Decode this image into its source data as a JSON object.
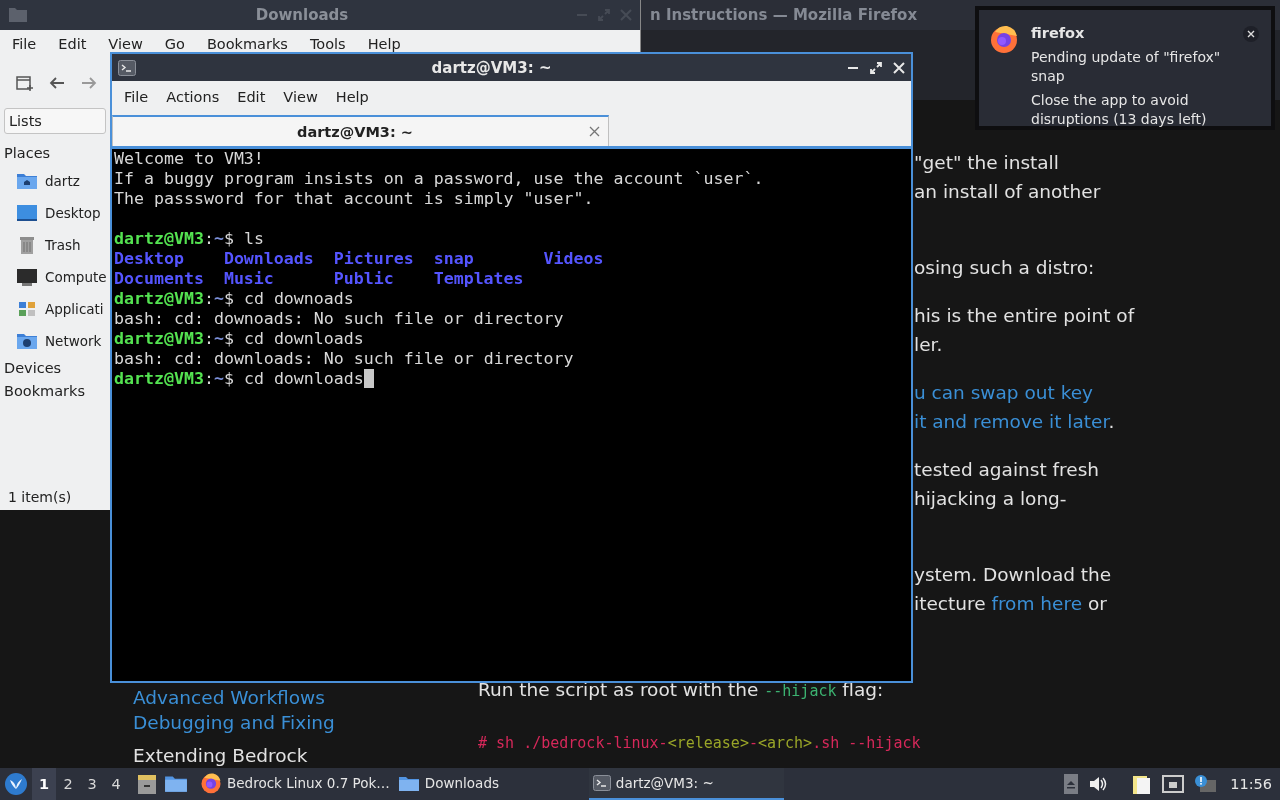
{
  "browser_window": {
    "title": "n Instructions — Mozilla Firefox",
    "nav_links": [
      {
        "text": "Advanced Workflows",
        "kind": "link"
      },
      {
        "text": "Debugging and Fixing",
        "kind": "link"
      },
      {
        "text": "Extending Bedrock",
        "kind": "heading"
      }
    ],
    "paragraphs": [
      [
        [
          {
            "text": "\"get\" the install",
            "kind": "text"
          }
        ],
        [
          {
            "text": "an install of another",
            "kind": "text"
          }
        ]
      ],
      [
        [
          {
            "text": "osing such a distro:",
            "kind": "text"
          }
        ]
      ],
      [
        [
          {
            "text": "his is the entire point of",
            "kind": "text"
          }
        ],
        [
          {
            "text": "ler.",
            "kind": "text"
          }
        ]
      ],
      [
        [
          {
            "text": "u can swap out key",
            "kind": "link"
          }
        ],
        [
          {
            "text": "it and remove it later",
            "kind": "link"
          },
          {
            "text": ".",
            "kind": "text"
          }
        ]
      ],
      [
        [
          {
            "text": "tested against fresh",
            "kind": "text"
          }
        ],
        [
          {
            "text": "hijacking a long-",
            "kind": "text"
          }
        ]
      ],
      [
        [
          {
            "text": "ystem. Download the",
            "kind": "text"
          }
        ],
        [
          {
            "text": "itecture ",
            "kind": "text"
          },
          {
            "text": "from here",
            "kind": "link"
          },
          {
            "text": " or",
            "kind": "text"
          }
        ]
      ]
    ],
    "instruction": [
      {
        "text": "Run the script as root with the ",
        "kind": "text"
      },
      {
        "text": "--hijack",
        "kind": "code"
      },
      {
        "text": " flag:",
        "kind": "text"
      }
    ],
    "command": [
      {
        "text": "# sh ./bedrock-linux-",
        "kind": "plain"
      },
      {
        "text": "<release>",
        "kind": "param"
      },
      {
        "text": "-",
        "kind": "plain"
      },
      {
        "text": "<arch>",
        "kind": "param"
      },
      {
        "text": ".sh --hijack",
        "kind": "plain"
      }
    ]
  },
  "file_manager": {
    "title": "Downloads",
    "menu": [
      "File",
      "Edit",
      "View",
      "Go",
      "Bookmarks",
      "Tools",
      "Help"
    ],
    "pane_mode": "Lists",
    "sections": [
      {
        "label": "Places",
        "items": [
          {
            "label": "dartz",
            "kind": "home"
          },
          {
            "label": "Desktop",
            "kind": "desktop"
          },
          {
            "label": "Trash",
            "kind": "trash"
          },
          {
            "label": "Compute",
            "kind": "computer"
          },
          {
            "label": "Applicati",
            "kind": "apps"
          },
          {
            "label": "Network",
            "kind": "network"
          }
        ]
      },
      {
        "label": "Devices"
      },
      {
        "label": "Bookmarks"
      }
    ],
    "status": "1 item(s)"
  },
  "terminal": {
    "title": "dartz@VM3: ~",
    "menu": [
      "File",
      "Actions",
      "Edit",
      "View",
      "Help"
    ],
    "tabs": [
      {
        "label": "dartz@VM3: ~",
        "selected": true
      }
    ],
    "lines": [
      {
        "kind": "output",
        "text": "Welcome to VM3!"
      },
      {
        "kind": "output",
        "text": "If a buggy program insists on a password, use the account `user`."
      },
      {
        "kind": "output",
        "text": "The passsword for that account is simply \"user\"."
      },
      {
        "kind": "blank"
      },
      {
        "kind": "prompt",
        "user": "dartz@VM3",
        "sep": ":",
        "path": "~",
        "sign": "$",
        "command": " ls"
      },
      {
        "kind": "dirs",
        "items": [
          "Desktop",
          "Downloads",
          "Pictures",
          "snap",
          "Videos"
        ]
      },
      {
        "kind": "dirs",
        "items": [
          "Documents",
          "Music",
          "Public",
          "Templates"
        ]
      },
      {
        "kind": "prompt",
        "user": "dartz@VM3",
        "sep": ":",
        "path": "~",
        "sign": "$",
        "command": " cd downoads"
      },
      {
        "kind": "output",
        "text": "bash: cd: downoads: No such file or directory"
      },
      {
        "kind": "prompt",
        "user": "dartz@VM3",
        "sep": ":",
        "path": "~",
        "sign": "$",
        "command": " cd downloads"
      },
      {
        "kind": "output",
        "text": "bash: cd: downloads: No such file or directory"
      },
      {
        "kind": "prompt",
        "user": "dartz@VM3",
        "sep": ":",
        "path": "~",
        "sign": "$",
        "command": " cd downloads",
        "cursor": true
      }
    ]
  },
  "notification": {
    "app": "firefox",
    "summary": "Pending update of \"firefox\" snap",
    "body": "Close the app to avoid disruptions (13 days left)"
  },
  "taskbar": {
    "workspaces": [
      {
        "label": "1",
        "selected": true
      },
      {
        "label": "2",
        "selected": false
      },
      {
        "label": "3",
        "selected": false
      },
      {
        "label": "4",
        "selected": false
      }
    ],
    "tasks": [
      {
        "label": "Bedrock Linux 0.7 Pok…",
        "kind": "browser",
        "selected": false
      },
      {
        "label": "Downloads",
        "kind": "folder",
        "selected": false
      },
      {
        "label": "dartz@VM3: ~",
        "kind": "terminal",
        "selected": true
      }
    ],
    "clock": "11:56"
  }
}
